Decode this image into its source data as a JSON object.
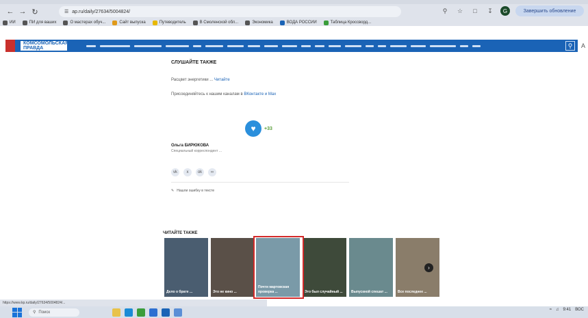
{
  "browser": {
    "url": "ap.ru/daily/27634/5004824/",
    "update_button": "Завершить обновление"
  },
  "bookmarks": [
    {
      "label": "ИИ",
      "color": "#555555"
    },
    {
      "label": "ПИ для ваших",
      "color": "#555555"
    },
    {
      "label": "О мастерах обуч...",
      "color": "#555555"
    },
    {
      "label": "Сайт выпуска",
      "color": "#e09a1a"
    },
    {
      "label": "Путеводитель",
      "color": "#e8b800"
    },
    {
      "label": "В Смоленской обл...",
      "color": "#555555"
    },
    {
      "label": "Экономика",
      "color": "#555555"
    },
    {
      "label": "ВОДА РОССИИ",
      "color": "#1a63b6"
    },
    {
      "label": "Таблица Кроссворд...",
      "color": "#3a9d3a"
    }
  ],
  "site": {
    "logo": "КОМСОМОЛЬСКАЯ ПРАВДА",
    "nav_link_widths": [
      14,
      44,
      40,
      34,
      12,
      26,
      24,
      18,
      20,
      22,
      14,
      14,
      18,
      24,
      12,
      12,
      24,
      22,
      38,
      12,
      12
    ]
  },
  "article": {
    "see_also": "СЛУШАЙТЕ ТАКЖЕ",
    "para1_text": "Расцвет энергетики ...",
    "para1_link": "Читайте",
    "para2_text": "Присоединяйтесь к нашим каналам в",
    "para2_link": "ВКонтакте и Max",
    "rating_count": "+33",
    "author_name": "Ольга БИРЮКОВА",
    "author_bio": "Специальный корреспондент ...",
    "report_text": "Нашли ошибку в тексте"
  },
  "read_also": "ЧИТАЙТЕ ТАКЖЕ",
  "cards": [
    {
      "caption": "Дело о брате ...",
      "bg": "#4a5d70"
    },
    {
      "caption": "Это не кино ...",
      "bg": "#5a5048"
    },
    {
      "caption": "Почти мартовская проверка ...",
      "bg": "#7a9aa8"
    },
    {
      "caption": "Это был случайный ...",
      "bg": "#3e4a3a"
    },
    {
      "caption": "Выпускной спешат ...",
      "bg": "#6a8a8e"
    },
    {
      "caption": "Все последнее ...",
      "bg": "#8a7d6a"
    }
  ],
  "status_url": "https://www.kp.ru/daily/27634/5004824/...",
  "taskbar": {
    "search_placeholder": "Поиск",
    "clock": "9:41",
    "date": "ВОС"
  }
}
